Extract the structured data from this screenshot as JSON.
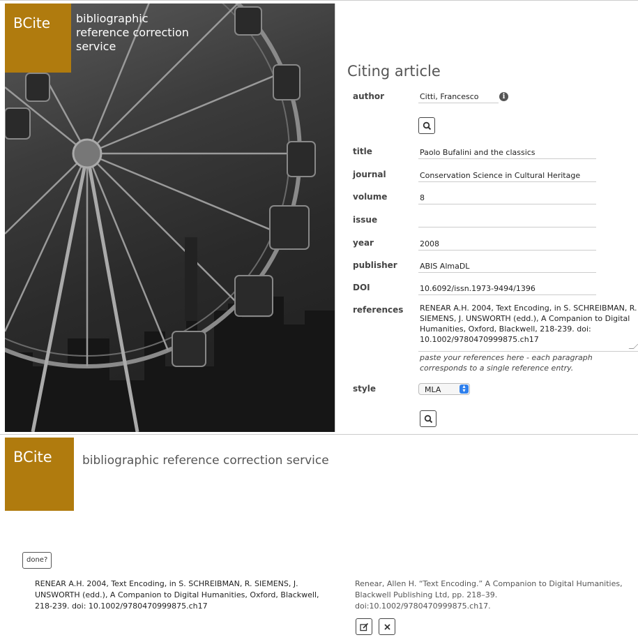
{
  "brand": {
    "logo": "BCite",
    "tagline_lines": [
      "bibliographic",
      "reference correction",
      "service"
    ],
    "tagline_full": "bibliographic reference correction service",
    "color": "#b07b0e"
  },
  "form": {
    "title": "Citing article",
    "author": {
      "label": "author",
      "value": "Citti, Francesco",
      "info_icon": "info-icon"
    },
    "search_icon": "search-icon",
    "title_field": {
      "label": "title",
      "value": "Paolo Bufalini and the classics"
    },
    "journal": {
      "label": "journal",
      "value": "Conservation Science in Cultural Heritage"
    },
    "volume": {
      "label": "volume",
      "value": "8"
    },
    "issue": {
      "label": "issue",
      "value": ""
    },
    "year": {
      "label": "year",
      "value": "2008"
    },
    "publisher": {
      "label": "publisher",
      "value": "ABIS AlmaDL"
    },
    "doi": {
      "label": "DOI",
      "value": "10.6092/issn.1973-9494/1396"
    },
    "references": {
      "label": "references",
      "lines": [
        "RENEAR A.H. 2004, Text Encoding, in S. SCHREIBMAN, R.",
        "SIEMENS, J. UNSWORTH (edd.), A Companion to Digital",
        "Humanities, Oxford, Blackwell, 218-239. doi:",
        "10.1002/9780470999875.ch17"
      ],
      "hint_lines": [
        "paste your references here - each paragraph",
        "corresponds to a single reference entry."
      ]
    },
    "style": {
      "label": "style",
      "selected": "MLA"
    }
  },
  "results": {
    "done_label": "done?",
    "original_lines": [
      "RENEAR A.H. 2004, Text Encoding, in S. SCHREIBMAN, R. SIEMENS, J.",
      "UNSWORTH (edd.), A Companion to Digital Humanities, Oxford, Blackwell,",
      "218-239. doi: 10.1002/9780470999875.ch17"
    ],
    "formatted_lines": [
      "Renear, Allen H. “Text Encoding.” A Companion to Digital Humanities,",
      "Blackwell Publishing Ltd, pp. 218–39.",
      "doi:10.1002/9780470999875.ch17."
    ],
    "edit_icon": "edit-icon",
    "close_icon": "close-icon"
  }
}
